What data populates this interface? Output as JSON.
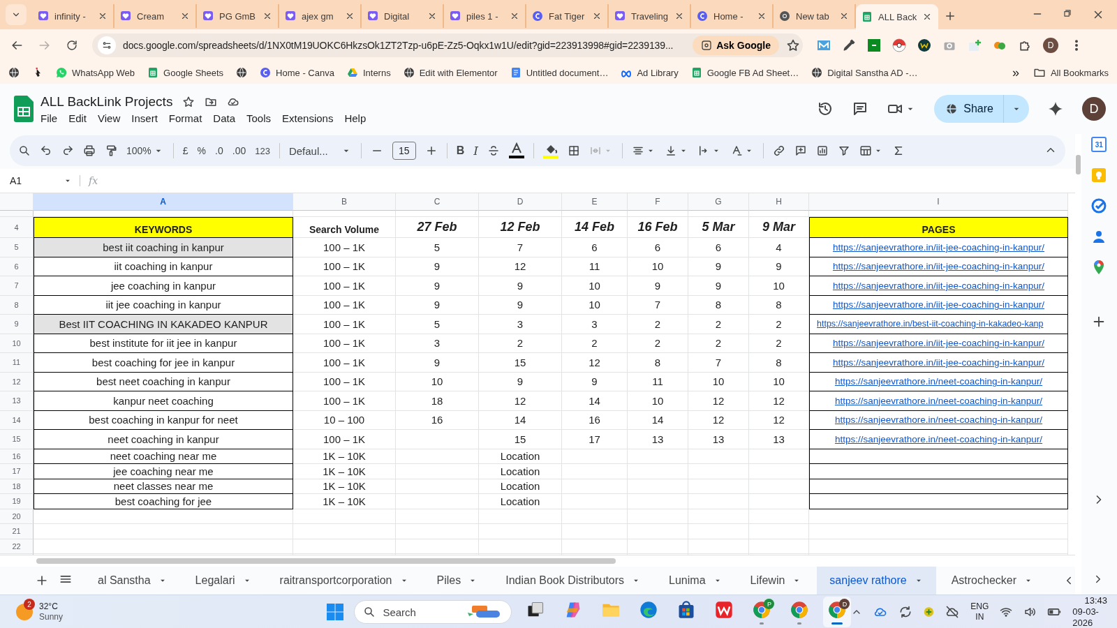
{
  "browser": {
    "tabs": [
      {
        "title": "infinity -",
        "kind": "heart",
        "selected": false
      },
      {
        "title": "Cream",
        "kind": "heart",
        "selected": false
      },
      {
        "title": "PG GmB",
        "kind": "heart",
        "selected": false
      },
      {
        "title": "ajex gm",
        "kind": "heart",
        "selected": false
      },
      {
        "title": "Digital",
        "kind": "heart",
        "selected": false
      },
      {
        "title": "piles 1 -",
        "kind": "heart",
        "selected": false
      },
      {
        "title": "Fat Tiger",
        "kind": "canva",
        "selected": false
      },
      {
        "title": "Traveling",
        "kind": "heart",
        "selected": false
      },
      {
        "title": "Home -",
        "kind": "canva",
        "selected": false
      },
      {
        "title": "New tab",
        "kind": "chrome",
        "selected": false
      },
      {
        "title": "ALL Back",
        "kind": "sheets",
        "selected": true
      }
    ],
    "address": "docs.google.com/spreadsheets/d/1NX0tM19UOKC6HkzsOk1ZT2Tzp-u6pE-Zz5-Oqkx1w1U/edit?gid=223913998#gid=2239139...",
    "ask_google": "Ask Google",
    "profile": "D",
    "bookmarks": [
      {
        "kind": "globe"
      },
      {
        "kind": "pointer"
      },
      {
        "kind": "whatsapp",
        "label": "WhatsApp Web"
      },
      {
        "kind": "sheets",
        "label": "Google Sheets"
      },
      {
        "kind": "globe"
      },
      {
        "kind": "canva",
        "label": "Home - Canva"
      },
      {
        "kind": "drive",
        "label": "Interns"
      },
      {
        "kind": "globe",
        "label": "Edit with Elementor"
      },
      {
        "kind": "docs",
        "label": "Untitled document…"
      },
      {
        "kind": "meta",
        "label": "Ad Library"
      },
      {
        "kind": "sheets",
        "label": "Google FB Ad Sheet…"
      },
      {
        "kind": "globe",
        "label": "Digital Sanstha AD -…"
      }
    ],
    "bookmarks_more": "»",
    "all_bookmarks": "All Bookmarks"
  },
  "sheet": {
    "title": "ALL BackLink Projects",
    "menu": [
      "File",
      "Edit",
      "View",
      "Insert",
      "Format",
      "Data",
      "Tools",
      "Extensions",
      "Help"
    ],
    "share": "Share",
    "avatar": "D",
    "toolbar": {
      "zoom": "100%",
      "currency": "£",
      "percent": "%",
      "decimal_decrease": ".0",
      "decimal_increase": ".00",
      "number_format": "123",
      "font": "Defaul...",
      "font_size": "15",
      "bold": "B",
      "italic": "I"
    },
    "name_box": "A1",
    "fx": "fx",
    "columns": [
      {
        "label": "A",
        "selected": true
      },
      {
        "label": "B",
        "selected": false
      },
      {
        "label": "C",
        "selected": false
      },
      {
        "label": "D",
        "selected": false
      },
      {
        "label": "E",
        "selected": false
      },
      {
        "label": "F",
        "selected": false
      },
      {
        "label": "G",
        "selected": false
      },
      {
        "label": "H",
        "selected": false
      },
      {
        "label": "I",
        "selected": false
      }
    ],
    "header": {
      "number": "4",
      "cells": [
        {
          "text": "KEYWORDS",
          "kind": "label",
          "color": "#ffff00"
        },
        {
          "text": "Search Volume",
          "kind": "label"
        },
        {
          "text": "27 Feb",
          "kind": "date"
        },
        {
          "text": "12 Feb",
          "kind": "date"
        },
        {
          "text": "14 Feb",
          "kind": "date"
        },
        {
          "text": "16 Feb",
          "kind": "date"
        },
        {
          "text": "5 Mar",
          "kind": "date"
        },
        {
          "text": "9 Mar",
          "kind": "date"
        },
        {
          "text": "PAGES",
          "kind": "label",
          "color": "#ffff00"
        }
      ]
    },
    "rows": [
      {
        "number": "5",
        "keyword": "best iit coaching in kanpur",
        "shaded": true,
        "volume": "100 – 1K",
        "values": {
          "C": "5",
          "D": "7",
          "E": "6",
          "F": "6",
          "G": "6",
          "H": "4"
        },
        "page": "https://sanjeevrathore.in/iit-jee-coaching-in-kanpur/"
      },
      {
        "number": "6",
        "keyword": "iit coaching in kanpur",
        "shaded": false,
        "volume": "100 – 1K",
        "values": {
          "C": "9",
          "D": "12",
          "E": "11",
          "F": "10",
          "G": "9",
          "H": "9"
        },
        "page": "https://sanjeevrathore.in/iit-jee-coaching-in-kanpur/"
      },
      {
        "number": "7",
        "keyword": "jee coaching in kanpur",
        "shaded": false,
        "volume": "100 – 1K",
        "values": {
          "C": "9",
          "D": "9",
          "E": "10",
          "F": "9",
          "G": "9",
          "H": "10"
        },
        "page": "https://sanjeevrathore.in/iit-jee-coaching-in-kanpur/"
      },
      {
        "number": "8",
        "keyword": "iit jee coaching in kanpur",
        "shaded": false,
        "volume": "100 – 1K",
        "values": {
          "C": "9",
          "D": "9",
          "E": "10",
          "F": "7",
          "G": "8",
          "H": "8"
        },
        "page": "https://sanjeevrathore.in/iit-jee-coaching-in-kanpur/"
      },
      {
        "number": "9",
        "keyword": "Best IIT COACHING IN KAKADEO KANPUR",
        "shaded": true,
        "volume": "100 – 1K",
        "values": {
          "C": "5",
          "D": "3",
          "E": "3",
          "F": "2",
          "G": "2",
          "H": "2"
        },
        "page": "https://sanjeevrathore.in/best-iit-coaching-in-kakadeo-kanp"
      },
      {
        "number": "10",
        "keyword": "best institute for iit jee in kanpur",
        "shaded": false,
        "volume": "100 – 1K",
        "values": {
          "C": "3",
          "D": "2",
          "E": "2",
          "F": "2",
          "G": "2",
          "H": "2"
        },
        "page": "https://sanjeevrathore.in/iit-jee-coaching-in-kanpur/"
      },
      {
        "number": "11",
        "keyword": "best coaching for jee in kanpur",
        "shaded": false,
        "volume": "100 – 1K",
        "values": {
          "C": "9",
          "D": "15",
          "E": "12",
          "F": "8",
          "G": "7",
          "H": "8"
        },
        "page": "https://sanjeevrathore.in/iit-jee-coaching-in-kanpur/"
      },
      {
        "number": "12",
        "keyword": "best neet coaching in kanpur",
        "shaded": false,
        "volume": "100 – 1K",
        "values": {
          "C": "10",
          "D": "9",
          "E": "9",
          "F": "11",
          "G": "10",
          "H": "10"
        },
        "page": "https://sanjeevrathore.in/neet-coaching-in-kanpur/"
      },
      {
        "number": "13",
        "keyword": "kanpur neet coaching",
        "shaded": false,
        "volume": "100 – 1K",
        "values": {
          "C": "18",
          "D": "12",
          "E": "14",
          "F": "10",
          "G": "12",
          "H": "12"
        },
        "page": "https://sanjeevrathore.in/neet-coaching-in-kanpur/"
      },
      {
        "number": "14",
        "keyword": "best coaching in kanpur for neet",
        "shaded": false,
        "volume": "10 – 100",
        "values": {
          "C": "16",
          "D": "14",
          "E": "16",
          "F": "14",
          "G": "12",
          "H": "12"
        },
        "page": "https://sanjeevrathore.in/neet-coaching-in-kanpur/"
      },
      {
        "number": "15",
        "keyword": "neet coaching in kanpur",
        "shaded": false,
        "volume": "100 – 1K",
        "values": {
          "D": "15",
          "E": "17",
          "F": "13",
          "G": "13",
          "H": "13"
        },
        "page": "https://sanjeevrathore.in/neet-coaching-in-kanpur/"
      },
      {
        "number": "16",
        "keyword": "neet coaching near me",
        "shaded": false,
        "volume": "1K – 10K",
        "values": {
          "D": "Location"
        }
      },
      {
        "number": "17",
        "keyword": "jee coaching near me",
        "shaded": false,
        "volume": "1K – 10K",
        "values": {
          "D": "Location"
        }
      },
      {
        "number": "18",
        "keyword": "neet classes near me",
        "shaded": false,
        "volume": "1K – 10K",
        "values": {
          "D": "Location"
        }
      },
      {
        "number": "19",
        "keyword": "best coaching for jee",
        "shaded": false,
        "volume": "1K – 10K",
        "values": {
          "D": "Location"
        }
      },
      {
        "number": "20"
      },
      {
        "number": "21"
      },
      {
        "number": "22"
      }
    ],
    "sheet_tabs": [
      {
        "label": "al Sanstha",
        "selected": false
      },
      {
        "label": "Legalari",
        "selected": false
      },
      {
        "label": "raitransportcorporation",
        "selected": false
      },
      {
        "label": "Piles",
        "selected": false
      },
      {
        "label": "Indian Book Distributors",
        "selected": false
      },
      {
        "label": "Lunima",
        "selected": false
      },
      {
        "label": "Lifewin",
        "selected": false
      },
      {
        "label": "sanjeev rathore",
        "selected": true
      },
      {
        "label": "Astrochecker",
        "selected": false
      }
    ],
    "calendar_day": "31"
  },
  "taskbar": {
    "weather": {
      "temp": "32°C",
      "condition": "Sunny",
      "badge": "2"
    },
    "search": "Search",
    "apps": [
      {
        "kind": "taskview",
        "open": false,
        "active": false
      },
      {
        "kind": "copilot",
        "open": false,
        "active": false
      },
      {
        "kind": "explorer",
        "open": false,
        "active": false
      },
      {
        "kind": "edge",
        "open": false,
        "active": false
      },
      {
        "kind": "store",
        "open": false,
        "active": false
      },
      {
        "kind": "wps",
        "open": false,
        "active": false
      },
      {
        "kind": "chrome",
        "badge": "P",
        "open": true,
        "active": false
      },
      {
        "kind": "chrome",
        "open": true,
        "active": false
      },
      {
        "kind": "chrome",
        "badge": "D",
        "open": true,
        "active": true
      }
    ],
    "language": "ENG",
    "region": "IN",
    "time": "13:43",
    "date": "09-03-2026"
  }
}
